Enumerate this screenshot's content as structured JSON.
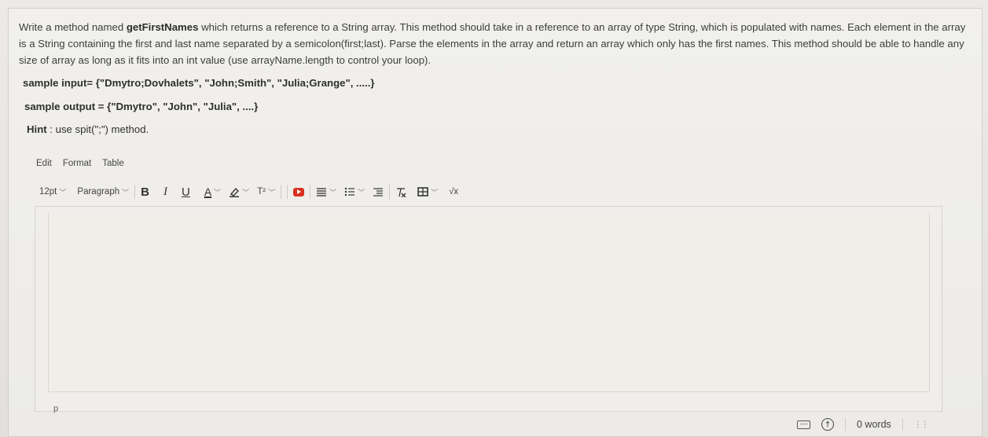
{
  "question": {
    "prefix": "Write a method named ",
    "method_name": "getFirstNames",
    "body": " which returns a reference to a String array. This method should take in a reference to an array of type String, which is populated with names. Each element in the array is a String containing the first and last name separated by a semicolon(first;last). Parse the elements in the array and return an array which only has the first names. This method should be able to handle any size of array as long as it fits into an int value (use arrayName.length to control your loop)."
  },
  "sample_input": "sample input= {\"Dmytro;Dovhalets\", \"John;Smith\", \"Julia;Grange\", .....}",
  "sample_output": "sample output = {\"Dmytro\", \"John\", \"Julia\", ....}",
  "hint": {
    "label": "Hint",
    "text": " : use spit(\";\") method."
  },
  "menubar": {
    "edit": "Edit",
    "format": "Format",
    "table": "Table"
  },
  "toolbar": {
    "font_size": "12pt",
    "block_format": "Paragraph",
    "bold": "B",
    "italic": "I",
    "underline": "U",
    "text_color": "A",
    "superscript": "T²",
    "equation": "√x"
  },
  "editor": {
    "path": "p"
  },
  "statusbar": {
    "word_count": "0 words"
  },
  "colors": {
    "media_icon": "#d9301f"
  }
}
